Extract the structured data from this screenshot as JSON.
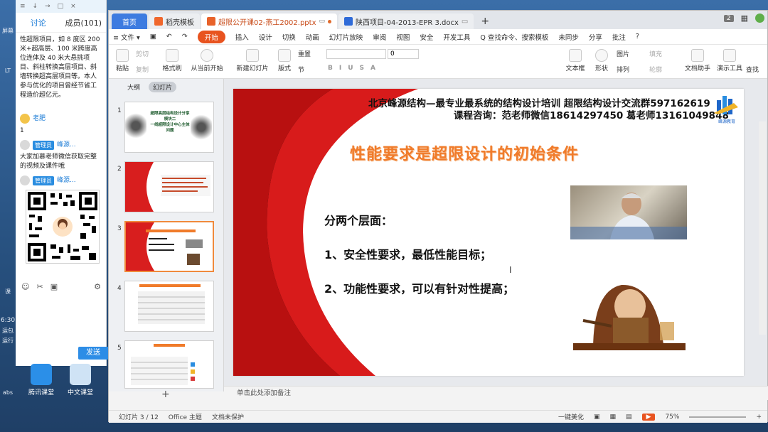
{
  "desktop_strip": {
    "labels": [
      "屏幕",
      "LT",
      "6:30",
      "运包",
      "运行",
      "课",
      "abs"
    ]
  },
  "chat": {
    "top_icons": [
      "≡",
      "↓",
      "→",
      "□",
      "×"
    ],
    "tabs": [
      "讨论",
      "成员(101)"
    ],
    "message1": "性超限项目，如 8 度区 200 米+超高层、100 米跨度高位连体及 40 米大悬挑项目、斜柱转换高层项目、斜墙转换超高层项目等。本人参与优化的项目曾经节省工程造价超亿元。",
    "user1": "老肥",
    "msg_user1": "1",
    "badge": "管理员",
    "user2": "峰源...",
    "message2": "大家加慕老师微信获取完整的视频及课件哦",
    "user3": "峰源...",
    "send": "发送",
    "send_drop": "▾"
  },
  "desktop_icons": [
    "腾讯课堂",
    "中文课堂"
  ],
  "wps": {
    "tabs": [
      {
        "label": "首页"
      },
      {
        "label": "稻壳模板"
      },
      {
        "label": "超限公开课02-燕工2002.pptx"
      },
      {
        "label": "陕西项目-04-2013-EPR 3.docx"
      }
    ],
    "tab_add": "+",
    "window_count": "2",
    "menu": [
      "≡ 文件 ▾",
      "开始",
      "插入",
      "设计",
      "切换",
      "动画",
      "幻灯片放映",
      "审阅",
      "视图",
      "安全",
      "开发工具",
      "Q 查找命令、搜索模板",
      "未同步",
      "分享",
      "批注",
      "?"
    ],
    "ribbon": {
      "paste": "粘贴",
      "cut": "剪切",
      "copy": "复制",
      "format": "格式刷",
      "from_current": "从当前开始",
      "new_slide": "新建幻灯片",
      "layout": "版式",
      "section": "节",
      "reset": "重置",
      "font_size": "0",
      "textbox": "文本框",
      "shape": "形状",
      "arrange": "排列",
      "picture": "图片",
      "fill": "填充",
      "outline": "轮廓",
      "doc_helper": "文档助手",
      "present_tools": "演示工具",
      "find": "查找"
    },
    "panel_tabs": [
      "大纲",
      "幻灯片"
    ],
    "thumb_numbers": [
      "1",
      "2",
      "3",
      "4",
      "5"
    ],
    "thumb1_text": [
      "超限高层结构设计分享",
      "模块二",
      "一线超限设计中心主体",
      "问题"
    ],
    "add_slide": "+",
    "slide": {
      "title1": "北京峰源结构—最专业最系统的结构设计培训   超限结构设计交流群597162619",
      "title2": "课程咨询：范老师微信18614297450   葛老师13161049848",
      "logo_text": "峰源教育",
      "main_title": "性能要求是超限设计的初始条件",
      "bullets": [
        "分两个层面：",
        "1、安全性要求，最低性能目标；",
        "2、功能性要求，可以有针对性提高；"
      ]
    },
    "notes": "单击此处添加备注",
    "status": {
      "slide_no": "幻灯片 3 / 12",
      "theme": "Office 主题",
      "protect": "文档未保护",
      "beautify": "一键美化",
      "zoom": "75%"
    }
  }
}
